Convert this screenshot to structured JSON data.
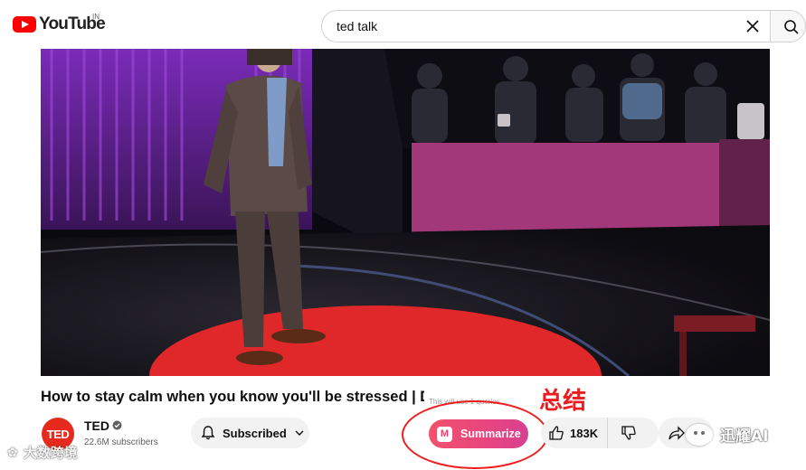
{
  "header": {
    "logo_text": "YouTube",
    "logo_region": "IN",
    "search_value": "ted talk"
  },
  "video": {
    "title": "How to stay calm when you know you'll be stressed | Da",
    "summarize_tooltip": "This will use 1 queries"
  },
  "channel": {
    "avatar_text": "TED",
    "name": "TED",
    "subscribers": "22.6M subscribers"
  },
  "actions": {
    "subscribe_label": "Subscribed",
    "summarize_label": "Summarize",
    "summarize_icon_letter": "M",
    "like_count": "183K"
  },
  "annotation": {
    "text": "总结"
  },
  "watermarks": {
    "left_text": "大数跨境",
    "right_text": "迅耀AI"
  },
  "colors": {
    "brand_red": "#ff0000",
    "ted_red": "#e62b1e",
    "summarize_gradient_start": "#f0526c",
    "summarize_gradient_end": "#d84191",
    "annotation_red": "#ee1c1c"
  },
  "icons": [
    "youtube-logo-icon",
    "clear-icon",
    "search-icon",
    "verified-icon",
    "bell-icon",
    "chevron-down-icon",
    "summarize-m-icon",
    "thumbs-up-icon",
    "thumbs-down-icon",
    "share-icon"
  ]
}
